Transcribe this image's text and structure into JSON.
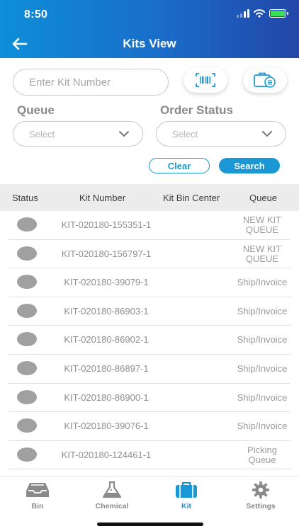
{
  "status_bar": {
    "time": "8:50"
  },
  "header": {
    "title": "Kits View"
  },
  "search": {
    "placeholder": "Enter Kit Number"
  },
  "filters": {
    "queue_label": "Queue",
    "queue_value": "Select",
    "order_status_label": "Order Status",
    "order_status_value": "Select"
  },
  "actions": {
    "clear": "Clear",
    "search": "Search"
  },
  "table": {
    "columns": {
      "status": "Status",
      "kit_number": "Kit Number",
      "bin_center": "Kit Bin Center",
      "queue": "Queue"
    },
    "rows": [
      {
        "kit": "KIT-020180-155351-1",
        "queue_l1": "NEW KIT",
        "queue_l2": "QUEUE"
      },
      {
        "kit": "KIT-020180-156797-1",
        "queue_l1": "NEW KIT",
        "queue_l2": "QUEUE"
      },
      {
        "kit": "KIT-020180-39079-1",
        "queue_l1": "Ship/Invoice",
        "queue_l2": ""
      },
      {
        "kit": "KIT-020180-86903-1",
        "queue_l1": "Ship/Invoice",
        "queue_l2": ""
      },
      {
        "kit": "KIT-020180-86902-1",
        "queue_l1": "Ship/Invoice",
        "queue_l2": ""
      },
      {
        "kit": "KIT-020180-86897-1",
        "queue_l1": "Ship/Invoice",
        "queue_l2": ""
      },
      {
        "kit": "KIT-020180-86900-1",
        "queue_l1": "Ship/Invoice",
        "queue_l2": ""
      },
      {
        "kit": "KIT-020180-39076-1",
        "queue_l1": "Ship/Invoice",
        "queue_l2": ""
      },
      {
        "kit": "KIT-020180-124461-1",
        "queue_l1": "Picking",
        "queue_l2": "Queue"
      }
    ]
  },
  "tabs": {
    "bin": "Bin",
    "chemical": "Chemical",
    "kit": "Kit",
    "settings": "Settings"
  },
  "colors": {
    "accent": "#1a98d6",
    "header_start": "#0e8fd8",
    "header_end": "#2346a8",
    "status_dot": "#a0a0a0"
  },
  "icons": {
    "back": "arrow-left-icon",
    "scan": "barcode-scan-icon",
    "kit_list": "kit-list-icon",
    "chevron": "chevron-down-icon",
    "bin": "inbox-tray-icon",
    "chemical": "flask-icon",
    "kit": "briefcase-icon",
    "settings": "gear-icon"
  }
}
